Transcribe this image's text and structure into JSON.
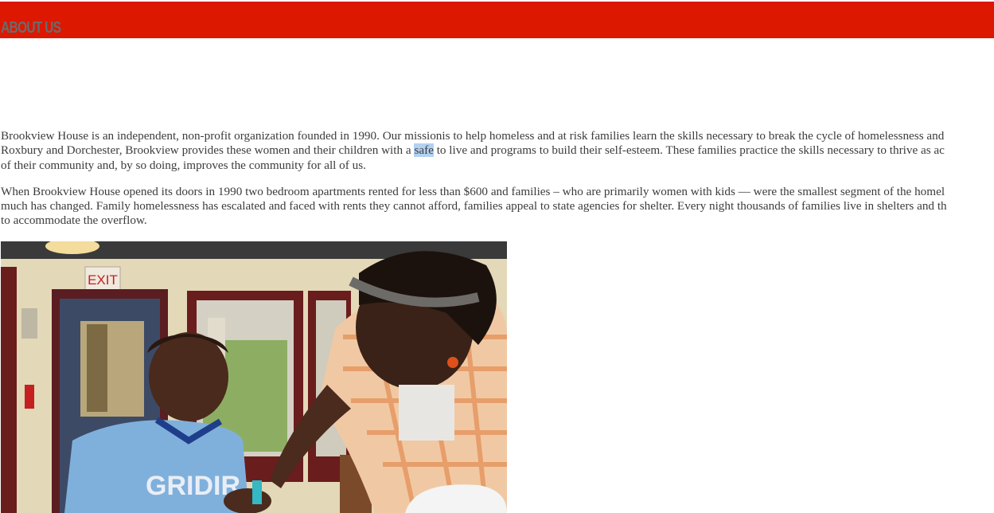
{
  "header": {
    "title": "ABOUT US",
    "bar_color": "#dc1800"
  },
  "about": {
    "paragraph1": {
      "line1": "Brookview House is an independent, non-profit organization founded in 1990. Our missionis to help homeless and at risk families learn the skills necessary to break the cycle of homelessness and",
      "line2_before": "Roxbury and Dorchester, Brookview provides these women and their children with a ",
      "line2_selected": "safe",
      "line2_after": " to live and programs to build their self-esteem. These families practice the skills necessary to thrive as ac",
      "line3": "of their community and, by so doing, improves the community for all of us."
    },
    "paragraph2": {
      "line1": "When Brookview House opened its doors in 1990 two bedroom apartments rented for less than $600 and families – who are primarily women with kids — were the smallest segment of the homel",
      "line2": "much has changed. Family homelessness has escalated and faced with rents they cannot afford, families appeal to state agencies for shelter. Every night thousands of families live in shelters and th",
      "line3": "to accommodate the overflow."
    }
  },
  "photo": {
    "exit_sign": "EXIT",
    "shirt_text": "GRIDIR"
  }
}
